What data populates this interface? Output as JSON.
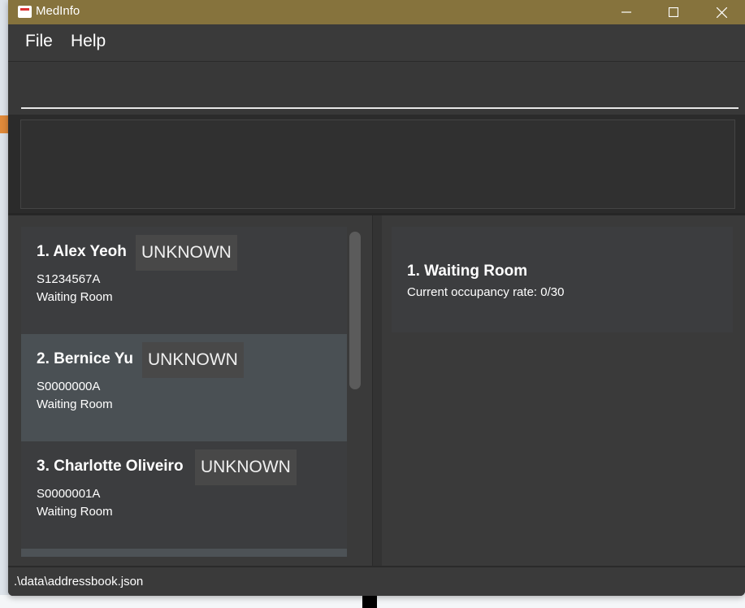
{
  "window": {
    "title": "MedInfo"
  },
  "menu": {
    "file": "File",
    "help": "Help"
  },
  "command": {
    "value": "",
    "placeholder": ""
  },
  "result": {
    "text": ""
  },
  "patients": [
    {
      "title": "1.  Alex Yeoh",
      "status": "UNKNOWN",
      "nric": "S1234567A",
      "location": "Waiting Room"
    },
    {
      "title": "2.  Bernice Yu",
      "status": "UNKNOWN",
      "nric": "S0000000A",
      "location": "Waiting Room"
    },
    {
      "title": "3.  Charlotte Oliveiro",
      "status": "UNKNOWN",
      "nric": "S0000001A",
      "location": "Waiting Room"
    }
  ],
  "wards": [
    {
      "title": "1.  Waiting Room",
      "occupancy": "Current occupancy rate: 0/30"
    }
  ],
  "status": {
    "path": ".\\data\\addressbook.json"
  },
  "colors": {
    "titlebar": "#86733d",
    "panel": "#3a3a3a",
    "card": "#3c3d3f",
    "card_selected": "#4a5054"
  }
}
